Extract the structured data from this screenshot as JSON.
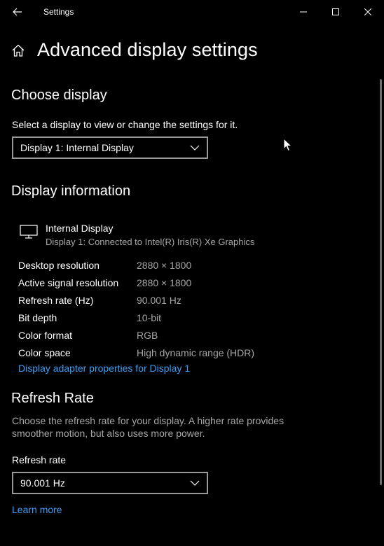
{
  "window": {
    "title": "Settings"
  },
  "header": {
    "title": "Advanced display settings"
  },
  "choose_display": {
    "title": "Choose display",
    "description": "Select a display to view or change the settings for it.",
    "selected": "Display 1: Internal Display"
  },
  "display_info": {
    "title": "Display information",
    "monitor_name": "Internal Display",
    "monitor_sub": "Display 1: Connected to Intel(R) Iris(R) Xe Graphics",
    "rows": [
      {
        "label": "Desktop resolution",
        "value": "2880 × 1800"
      },
      {
        "label": "Active signal resolution",
        "value": "2880 × 1800"
      },
      {
        "label": "Refresh rate (Hz)",
        "value": "90.001 Hz"
      },
      {
        "label": "Bit depth",
        "value": "10-bit"
      },
      {
        "label": "Color format",
        "value": "RGB"
      },
      {
        "label": "Color space",
        "value": "High dynamic range (HDR)"
      }
    ],
    "adapter_link": "Display adapter properties for Display 1"
  },
  "refresh_rate": {
    "title": "Refresh Rate",
    "description": "Choose the refresh rate for your display. A higher rate provides smoother motion, but also uses more power.",
    "field_label": "Refresh rate",
    "selected": "90.001 Hz",
    "learn_more": "Learn more"
  },
  "icons": {
    "back": "back-arrow-icon",
    "minimize": "minimize-icon",
    "maximize": "maximize-icon",
    "close": "close-icon",
    "home": "home-icon",
    "monitor": "monitor-icon",
    "chevron": "chevron-down-icon"
  },
  "colors": {
    "background": "#000000",
    "text": "#ffffff",
    "muted": "#a6a6a6",
    "link": "#3b9ef5",
    "border": "#999999"
  }
}
